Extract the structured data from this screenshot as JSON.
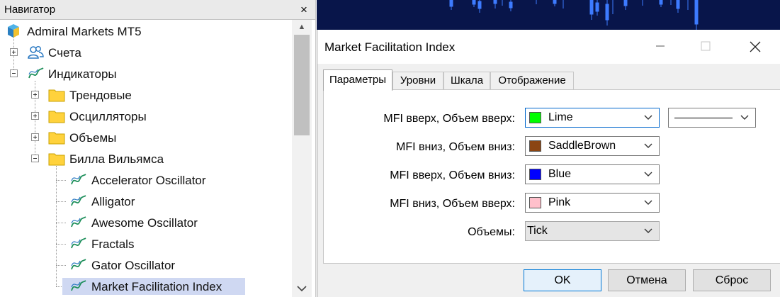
{
  "navigator": {
    "title": "Навигатор",
    "close": "×",
    "tree": [
      {
        "label": "Admiral Markets MT5",
        "icon": "broker-logo-icon",
        "toggle": "none"
      },
      {
        "label": "Счета",
        "icon": "accounts-icon",
        "toggle": "plus"
      },
      {
        "label": "Индикаторы",
        "icon": "indicator-icon",
        "toggle": "minus"
      },
      {
        "label": "Трендовые",
        "icon": "folder-icon",
        "toggle": "plus"
      },
      {
        "label": "Осцилляторы",
        "icon": "folder-icon",
        "toggle": "plus"
      },
      {
        "label": "Объемы",
        "icon": "folder-icon",
        "toggle": "plus"
      },
      {
        "label": "Билла Вильямса",
        "icon": "folder-icon",
        "toggle": "minus"
      },
      {
        "label": "Accelerator Oscillator",
        "icon": "indicator-icon",
        "toggle": "none"
      },
      {
        "label": "Alligator",
        "icon": "indicator-icon",
        "toggle": "none"
      },
      {
        "label": "Awesome Oscillator",
        "icon": "indicator-icon",
        "toggle": "none"
      },
      {
        "label": "Fractals",
        "icon": "indicator-icon",
        "toggle": "none"
      },
      {
        "label": "Gator Oscillator",
        "icon": "indicator-icon",
        "toggle": "none"
      },
      {
        "label": "Market Facilitation Index",
        "icon": "indicator-icon",
        "toggle": "none",
        "selected": true
      }
    ]
  },
  "dialog": {
    "title": "Market Facilitation Index",
    "tabs": [
      "Параметры",
      "Уровни",
      "Шкала",
      "Отображение"
    ],
    "active_tab": 0,
    "params": [
      {
        "label": "MFI вверх, Объем вверх:",
        "value": "Lime",
        "color": "#00ff00"
      },
      {
        "label": "MFI вниз, Объем вниз:",
        "value": "SaddleBrown",
        "color": "#8b4513"
      },
      {
        "label": "MFI вверх, Объем вниз:",
        "value": "Blue",
        "color": "#0000ff"
      },
      {
        "label": "MFI вниз, Объем вверх:",
        "value": "Pink",
        "color": "#ffc0cb"
      },
      {
        "label": "Объемы:",
        "value": "Tick",
        "color": ""
      }
    ],
    "buttons": {
      "ok": "OK",
      "cancel": "Отмена",
      "reset": "Сброс"
    }
  },
  "colors": {
    "chart_background": "#08154a",
    "chart_candles": "#3d7bff",
    "selection": "#cfd8f2",
    "folder": "#ffd23c",
    "indicator_line": "#1e8f5a"
  }
}
